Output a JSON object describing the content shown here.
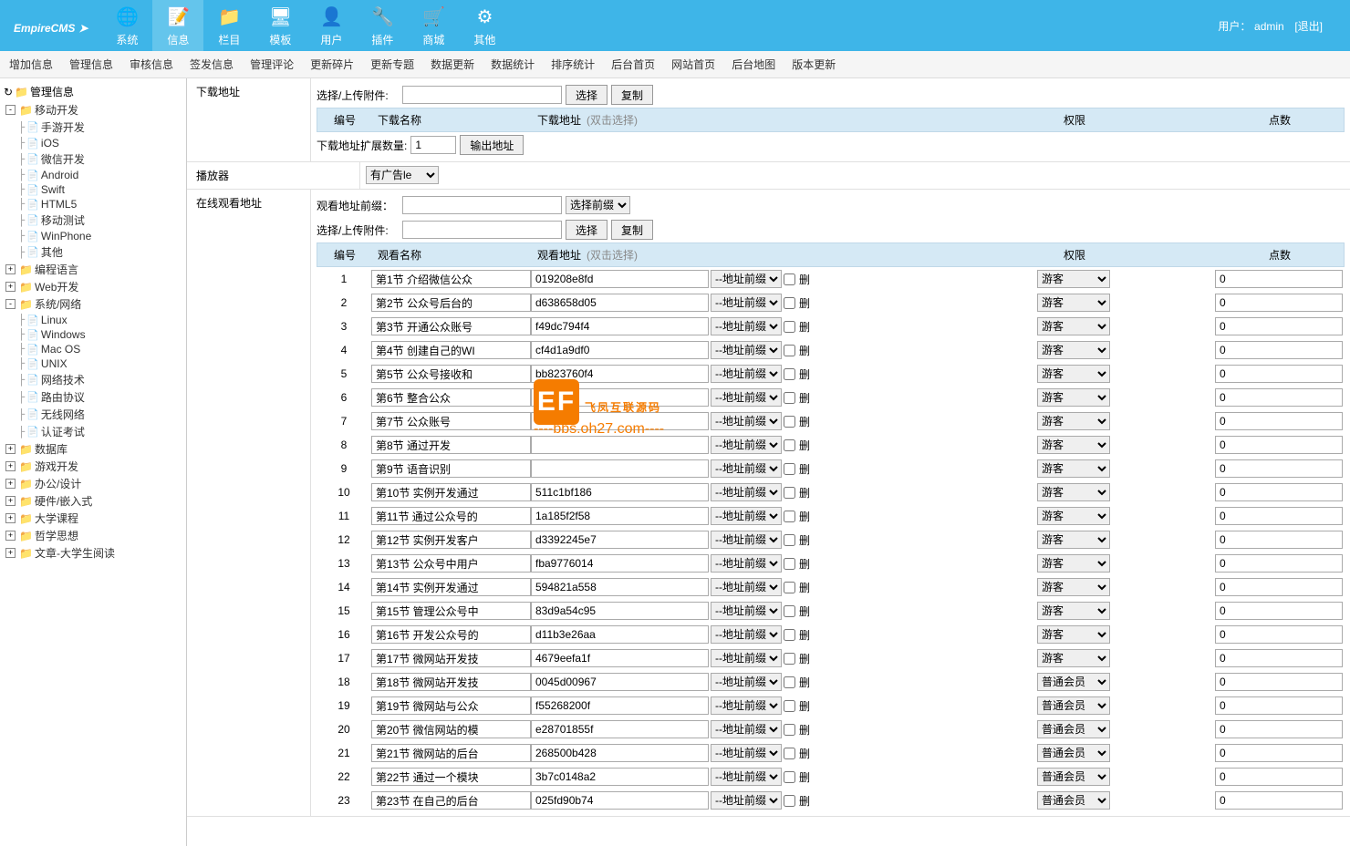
{
  "logo": "EmpireCMS",
  "user": {
    "label": "用户：",
    "name": "admin",
    "logout": "[退出]"
  },
  "nav": [
    {
      "label": "系统",
      "id": "system"
    },
    {
      "label": "信息",
      "id": "info",
      "active": true
    },
    {
      "label": "栏目",
      "id": "column"
    },
    {
      "label": "模板",
      "id": "template"
    },
    {
      "label": "用户",
      "id": "user"
    },
    {
      "label": "插件",
      "id": "plugin"
    },
    {
      "label": "商城",
      "id": "shop"
    },
    {
      "label": "其他",
      "id": "other"
    }
  ],
  "subnav": [
    "增加信息",
    "管理信息",
    "审核信息",
    "签发信息",
    "管理评论",
    "更新碎片",
    "更新专题",
    "数据更新",
    "数据统计",
    "排序统计",
    "后台首页",
    "网站首页",
    "后台地图",
    "版本更新"
  ],
  "tree": {
    "root": "管理信息",
    "items": [
      {
        "exp": "-",
        "depth": 1,
        "icon": "f",
        "label": "移动开发"
      },
      {
        "exp": "",
        "depth": 2,
        "icon": "p",
        "label": "手游开发"
      },
      {
        "exp": "",
        "depth": 2,
        "icon": "p",
        "label": "iOS"
      },
      {
        "exp": "",
        "depth": 2,
        "icon": "p",
        "label": "微信开发"
      },
      {
        "exp": "",
        "depth": 2,
        "icon": "p",
        "label": "Android"
      },
      {
        "exp": "",
        "depth": 2,
        "icon": "p",
        "label": "Swift"
      },
      {
        "exp": "",
        "depth": 2,
        "icon": "p",
        "label": "HTML5"
      },
      {
        "exp": "",
        "depth": 2,
        "icon": "p",
        "label": "移动测试"
      },
      {
        "exp": "",
        "depth": 2,
        "icon": "p",
        "label": "WinPhone"
      },
      {
        "exp": "",
        "depth": 2,
        "icon": "p",
        "label": "其他"
      },
      {
        "exp": "+",
        "depth": 1,
        "icon": "f",
        "label": "编程语言"
      },
      {
        "exp": "+",
        "depth": 1,
        "icon": "f",
        "label": "Web开发"
      },
      {
        "exp": "-",
        "depth": 1,
        "icon": "f",
        "label": "系统/网络"
      },
      {
        "exp": "",
        "depth": 2,
        "icon": "p",
        "label": "Linux"
      },
      {
        "exp": "",
        "depth": 2,
        "icon": "p",
        "label": "Windows"
      },
      {
        "exp": "",
        "depth": 2,
        "icon": "p",
        "label": "Mac OS"
      },
      {
        "exp": "",
        "depth": 2,
        "icon": "p",
        "label": "UNIX"
      },
      {
        "exp": "",
        "depth": 2,
        "icon": "p",
        "label": "网络技术"
      },
      {
        "exp": "",
        "depth": 2,
        "icon": "p",
        "label": "路由协议"
      },
      {
        "exp": "",
        "depth": 2,
        "icon": "p",
        "label": "无线网络"
      },
      {
        "exp": "",
        "depth": 2,
        "icon": "p",
        "label": "认证考试"
      },
      {
        "exp": "+",
        "depth": 1,
        "icon": "f",
        "label": "数据库"
      },
      {
        "exp": "+",
        "depth": 1,
        "icon": "f",
        "label": "游戏开发"
      },
      {
        "exp": "+",
        "depth": 1,
        "icon": "f",
        "label": "办公/设计"
      },
      {
        "exp": "+",
        "depth": 1,
        "icon": "f",
        "label": "硬件/嵌入式"
      },
      {
        "exp": "+",
        "depth": 1,
        "icon": "f",
        "label": "大学课程"
      },
      {
        "exp": "+",
        "depth": 1,
        "icon": "f",
        "label": "哲学思想"
      },
      {
        "exp": "+",
        "depth": 1,
        "icon": "f",
        "label": "文章-大学生阅读"
      }
    ]
  },
  "form": {
    "download_label": "下载地址",
    "upload_label": "选择/上传附件:",
    "select_btn": "选择",
    "copy_btn": "复制",
    "dl_header": {
      "num": "编号",
      "name": "下载名称",
      "addr": "下载地址",
      "addr_hint": "(双击选择)",
      "perm": "权限",
      "pts": "点数"
    },
    "expand_label": "下载地址扩展数量:",
    "expand_val": "1",
    "output_btn": "输出地址",
    "player_label": "播放器",
    "player_val": "有广告le",
    "view_prefix_label": "观看地址前缀：",
    "select_prefix_btn": "选择前缀",
    "view_header": {
      "num": "编号",
      "name": "观看名称",
      "addr": "观看地址",
      "addr_hint": "(双击选择)",
      "perm": "权限",
      "pts": "点数"
    },
    "online_view_label": "在线观看地址",
    "addr_prefix_opt": "--地址前缀--",
    "del_label": "删",
    "rows": [
      {
        "n": 1,
        "name": "第1节 介绍微信公众",
        "addr": "019208e8fd",
        "perm": "游客",
        "pts": "0"
      },
      {
        "n": 2,
        "name": "第2节 公众号后台的",
        "addr": "d638658d05",
        "perm": "游客",
        "pts": "0"
      },
      {
        "n": 3,
        "name": "第3节 开通公众账号",
        "addr": "f49dc794f4",
        "perm": "游客",
        "pts": "0"
      },
      {
        "n": 4,
        "name": "第4节 创建自己的WI",
        "addr": "cf4d1a9df0",
        "perm": "游客",
        "pts": "0"
      },
      {
        "n": 5,
        "name": "第5节 公众号接收和",
        "addr": "bb823760f4",
        "perm": "游客",
        "pts": "0"
      },
      {
        "n": 6,
        "name": "第6节 整合公众",
        "addr": "",
        "perm": "游客",
        "pts": "0"
      },
      {
        "n": 7,
        "name": "第7节 公众账号",
        "addr": "",
        "perm": "游客",
        "pts": "0"
      },
      {
        "n": 8,
        "name": "第8节 通过开发",
        "addr": "",
        "perm": "游客",
        "pts": "0"
      },
      {
        "n": 9,
        "name": "第9节 语音识别",
        "addr": "",
        "perm": "游客",
        "pts": "0"
      },
      {
        "n": 10,
        "name": "第10节 实例开发通过",
        "addr": "511c1bf186",
        "perm": "游客",
        "pts": "0"
      },
      {
        "n": 11,
        "name": "第11节 通过公众号的",
        "addr": "1a185f2f58",
        "perm": "游客",
        "pts": "0"
      },
      {
        "n": 12,
        "name": "第12节 实例开发客户",
        "addr": "d3392245e7",
        "perm": "游客",
        "pts": "0"
      },
      {
        "n": 13,
        "name": "第13节 公众号中用户",
        "addr": "fba9776014",
        "perm": "游客",
        "pts": "0"
      },
      {
        "n": 14,
        "name": "第14节 实例开发通过",
        "addr": "594821a558",
        "perm": "游客",
        "pts": "0"
      },
      {
        "n": 15,
        "name": "第15节 管理公众号中",
        "addr": "83d9a54c95",
        "perm": "游客",
        "pts": "0"
      },
      {
        "n": 16,
        "name": "第16节 开发公众号的",
        "addr": "d11b3e26aa",
        "perm": "游客",
        "pts": "0"
      },
      {
        "n": 17,
        "name": "第17节 微网站开发技",
        "addr": "4679eefa1f",
        "perm": "游客",
        "pts": "0"
      },
      {
        "n": 18,
        "name": "第18节 微网站开发技",
        "addr": "0045d00967",
        "perm": "普通会员",
        "pts": "0"
      },
      {
        "n": 19,
        "name": "第19节 微网站与公众",
        "addr": "f55268200f",
        "perm": "普通会员",
        "pts": "0"
      },
      {
        "n": 20,
        "name": "第20节 微信网站的模",
        "addr": "e28701855f",
        "perm": "普通会员",
        "pts": "0"
      },
      {
        "n": 21,
        "name": "第21节 微网站的后台",
        "addr": "268500b428",
        "perm": "普通会员",
        "pts": "0"
      },
      {
        "n": 22,
        "name": "第22节 通过一个模块",
        "addr": "3b7c0148a2",
        "perm": "普通会员",
        "pts": "0"
      },
      {
        "n": 23,
        "name": "第23节 在自己的后台",
        "addr": "025fd90b74",
        "perm": "普通会员",
        "pts": "0"
      }
    ]
  },
  "watermark": {
    "big": "飞凤互联源码",
    "small": "----bbs.oh27.com----"
  }
}
